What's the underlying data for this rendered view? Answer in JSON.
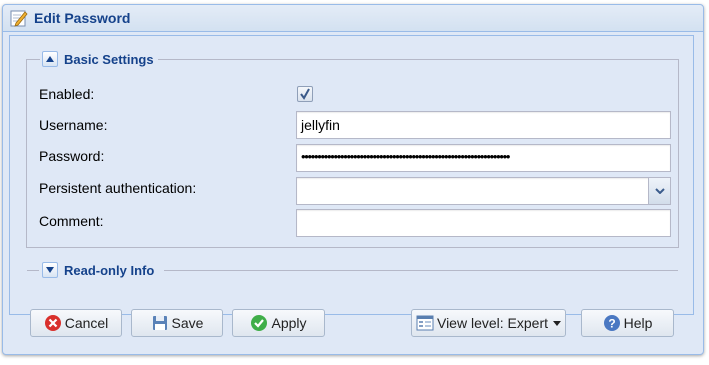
{
  "window": {
    "title": "Edit Password",
    "icon": "edit-pencil-icon"
  },
  "basic_settings": {
    "legend": "Basic Settings",
    "collapsed": false,
    "fields": {
      "enabled": {
        "label": "Enabled:",
        "checked": true
      },
      "username": {
        "label": "Username:",
        "value": "jellyfin"
      },
      "password": {
        "label": "Password:",
        "value": "••••••••••••••••••••••••••••••••••••••••••••••••••••••••••••••••"
      },
      "persistent_auth": {
        "label": "Persistent authentication:",
        "value": ""
      },
      "comment": {
        "label": "Comment:",
        "value": ""
      }
    }
  },
  "readonly_info": {
    "legend": "Read-only Info",
    "collapsed": true
  },
  "buttons": {
    "cancel": "Cancel",
    "save": "Save",
    "apply": "Apply",
    "view_level": "View level: Expert",
    "help": "Help"
  },
  "colors": {
    "title_text": "#15428b",
    "panel_bg": "#dfe8f6",
    "border": "#99bbe8"
  }
}
